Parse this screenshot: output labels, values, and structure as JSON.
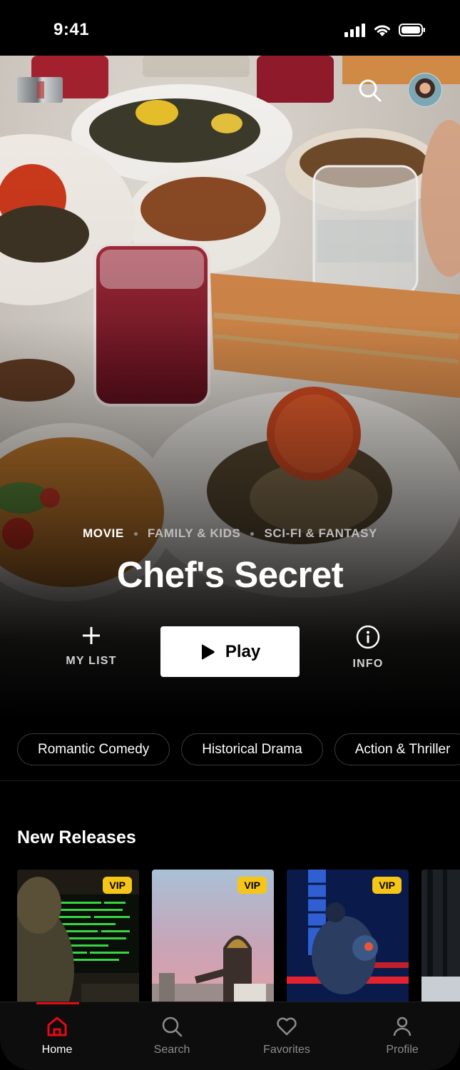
{
  "status_bar": {
    "time": "9:41"
  },
  "header": {
    "logo_icon": "app-logo-icon",
    "search_icon": "search-icon",
    "avatar_icon": "profile-avatar"
  },
  "hero": {
    "genres": [
      "MOVIE",
      "FAMILY & KIDS",
      "SCI-FI & FANTASY"
    ],
    "title": "Chef's Secret",
    "my_list_label": "MY LIST",
    "play_label": "Play",
    "info_label": "INFO"
  },
  "categories": [
    "Romantic Comedy",
    "Historical Drama",
    "Action & Thriller"
  ],
  "new_releases": {
    "title": "New Releases",
    "items": [
      {
        "badge": "VIP"
      },
      {
        "badge": "VIP"
      },
      {
        "badge": "VIP"
      },
      {
        "badge": ""
      }
    ]
  },
  "tabs": [
    {
      "label": "Home",
      "icon": "home-icon",
      "active": true
    },
    {
      "label": "Search",
      "icon": "search-icon",
      "active": false
    },
    {
      "label": "Favorites",
      "icon": "heart-icon",
      "active": false
    },
    {
      "label": "Profile",
      "icon": "user-icon",
      "active": false
    }
  ],
  "colors": {
    "accent": "#e50914",
    "badge": "#f5c518",
    "background": "#000000"
  }
}
